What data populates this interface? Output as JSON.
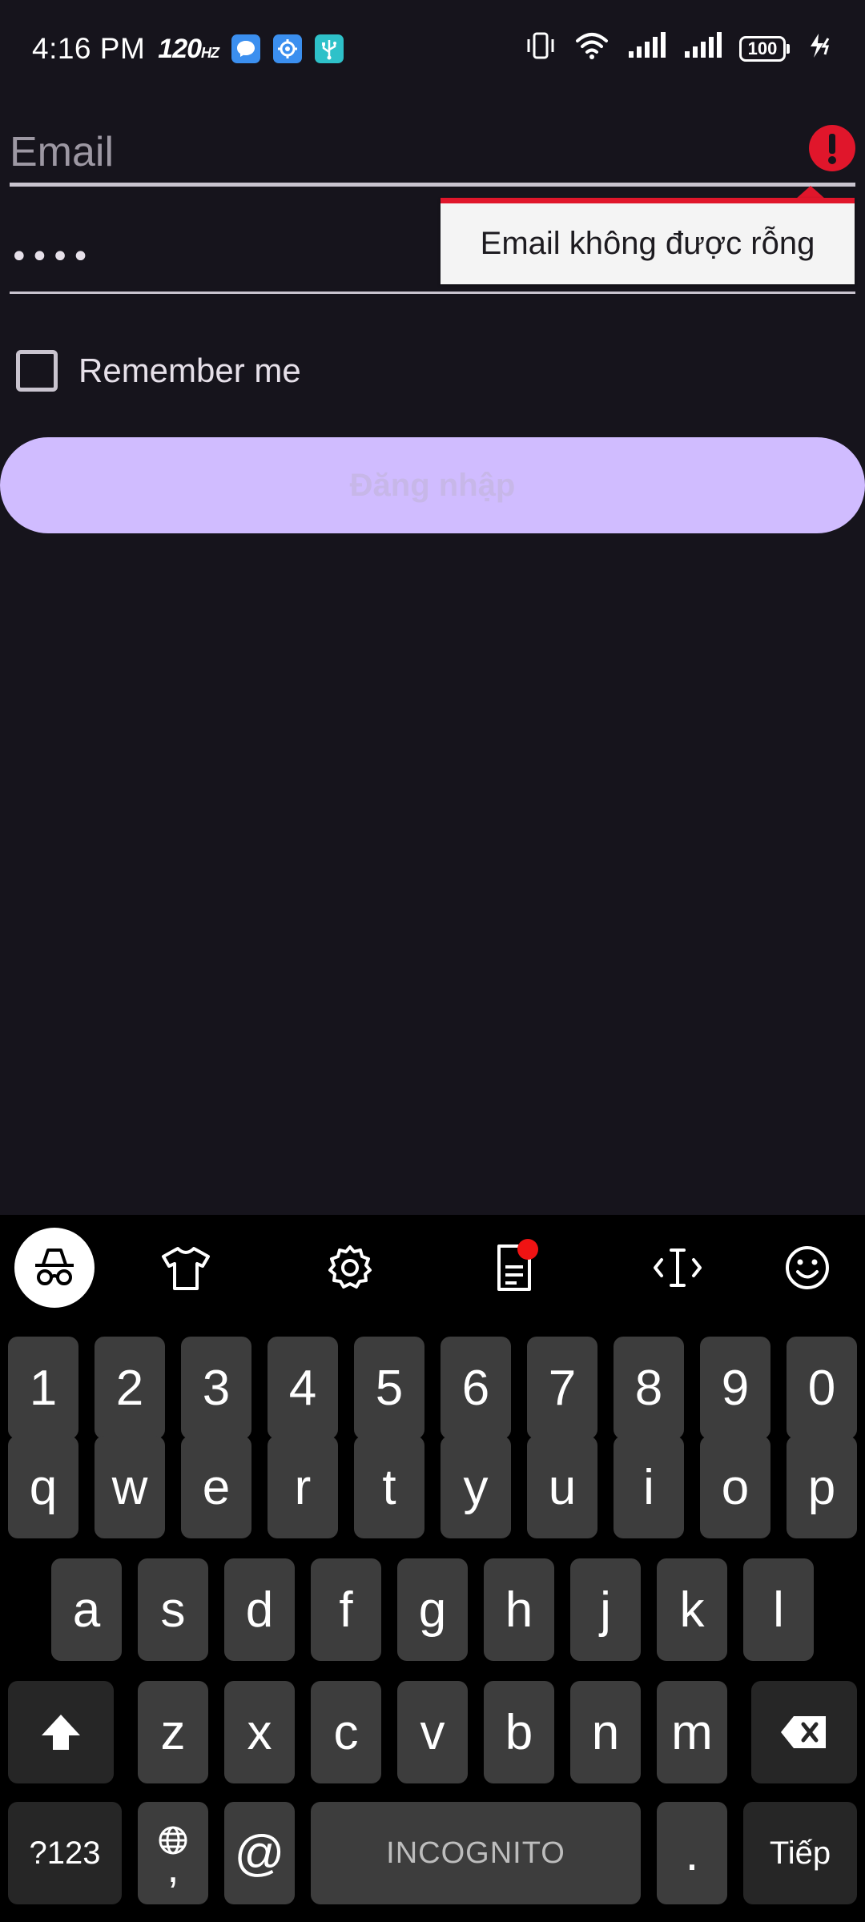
{
  "status_bar": {
    "time": "4:16 PM",
    "refresh_rate": "120",
    "refresh_unit": "HZ",
    "battery_level": "100",
    "icons": [
      "messenger-icon",
      "settings-app-icon",
      "usb-icon",
      "vibrate-icon",
      "wifi-icon",
      "signal-icon",
      "signal-icon",
      "battery-icon",
      "charging-icon"
    ]
  },
  "form": {
    "email_placeholder": "Email",
    "email_value": "",
    "email_error": "Email không được rỗng",
    "password_mask": "••••",
    "remember_label": "Remember me",
    "remember_checked": false,
    "login_label": "Đăng nhập"
  },
  "keyboard": {
    "toolbar": [
      "incognito-icon",
      "theme-shirt-icon",
      "gear-icon",
      "clipboard-icon",
      "text-cursor-icon",
      "emoji-icon"
    ],
    "row_numbers": [
      "1",
      "2",
      "3",
      "4",
      "5",
      "6",
      "7",
      "8",
      "9",
      "0"
    ],
    "row_top": [
      "q",
      "w",
      "e",
      "r",
      "t",
      "y",
      "u",
      "i",
      "o",
      "p"
    ],
    "row_middle": [
      "a",
      "s",
      "d",
      "f",
      "g",
      "h",
      "j",
      "k",
      "l"
    ],
    "row_bottom": [
      "z",
      "x",
      "c",
      "v",
      "b",
      "n",
      "m"
    ],
    "symbols_label": "?123",
    "comma_label": ",",
    "at_label": "@",
    "space_label": "INCOGNITO",
    "period_label": ".",
    "enter_label": "Tiếp"
  },
  "colors": {
    "background": "#16141c",
    "accent_button": "#d0bcff",
    "error": "#e0162b",
    "keyboard_key": "#3d3d3d"
  }
}
